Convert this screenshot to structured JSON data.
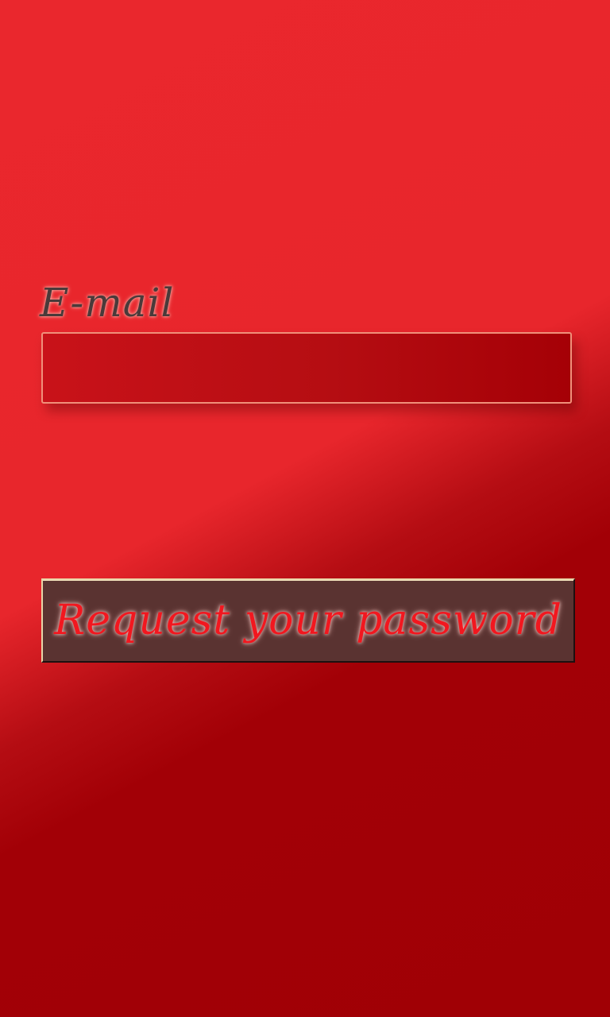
{
  "form": {
    "email_label": "E-mail",
    "email_value": "",
    "email_placeholder": "",
    "submit_label": "Request your password"
  },
  "colors": {
    "background_light": "#ea272d",
    "background_dark": "#a00005",
    "input_border": "#f0907a",
    "button_background": "#5a3331",
    "button_text": "#f2171f",
    "label_text": "#4a3a3a"
  }
}
